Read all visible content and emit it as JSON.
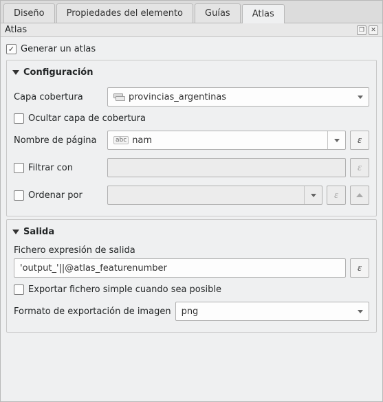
{
  "tabs": {
    "design": "Diseño",
    "item_props": "Propiedades del elemento",
    "guides": "Guías",
    "atlas": "Atlas"
  },
  "panel": {
    "title": "Atlas"
  },
  "generate_atlas": {
    "label": "Generar un atlas"
  },
  "config": {
    "header": "Configuración",
    "coverage_layer": {
      "label": "Capa cobertura",
      "value": "provincias_argentinas"
    },
    "hide_coverage": {
      "label": "Ocultar capa de cobertura"
    },
    "page_name": {
      "label": "Nombre de página",
      "value": "nam"
    },
    "filter_with": {
      "label": "Filtrar con",
      "value": ""
    },
    "order_by": {
      "label": "Ordenar por",
      "value": ""
    },
    "expr_btn": "ε"
  },
  "output": {
    "header": "Salida",
    "file_expr_label": "Fichero expresión de salida",
    "file_expr_value": "'output_'||@atlas_featurenumber",
    "export_single": {
      "label": "Exportar fichero simple cuando sea posible"
    },
    "image_format": {
      "label": "Formato de exportación de imagen",
      "value": "png"
    },
    "expr_btn": "ε"
  }
}
